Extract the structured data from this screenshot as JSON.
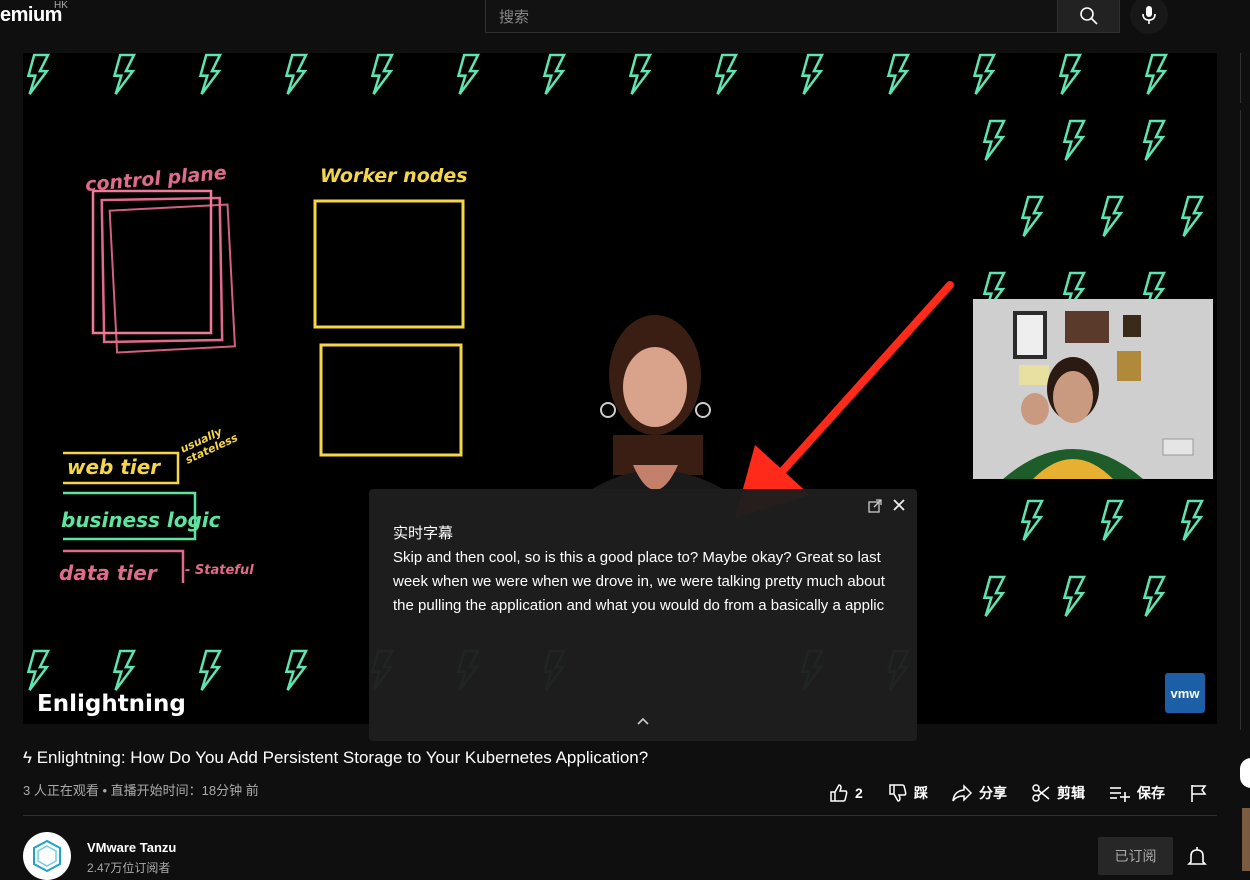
{
  "topbar": {
    "logo": "emium",
    "region": "HK",
    "search_placeholder": "搜索",
    "search_icon": "search-icon",
    "mic_icon": "microphone-icon"
  },
  "video": {
    "whiteboard": {
      "control_plane": "control plane",
      "worker_nodes": "Worker nodes",
      "web_tier": "web tier",
      "usually_stateless": "usually stateless",
      "business_logic": "business logic",
      "data_tier": "data tier",
      "stateful": "- Stateful"
    },
    "brand": "Enlightning",
    "vmw_logo": "vmw"
  },
  "captions": {
    "title": "实时字幕",
    "text": "Skip and then cool, so is this a good place to? Maybe okay? Great so last week when we were when we drove in, we were talking pretty much about the pulling the application and what you would do from a basically a applic",
    "popout_icon": "popout-icon",
    "close_icon": "close-icon",
    "collapse_icon": "chevron-up-icon"
  },
  "info": {
    "title": "ϟ Enlightning: How Do You Add Persistent Storage to Your Kubernetes Application?",
    "meta": "3 人正在观看 • 直播开始时间：18分钟 前",
    "actions": {
      "like_count": "2",
      "dislike": "踩",
      "share": "分享",
      "clip": "剪辑",
      "save": "保存"
    }
  },
  "channel": {
    "name": "VMware Tanzu",
    "subscribers": "2.47万位订阅者",
    "subscribed_label": "已订阅"
  },
  "colors": {
    "background": "#0f0f0f",
    "bolt": "#5fe3b0",
    "arrow": "#ff2a1a",
    "pink": "#e06b8b",
    "yellow": "#f5d64a",
    "green": "#5fe3a0"
  }
}
